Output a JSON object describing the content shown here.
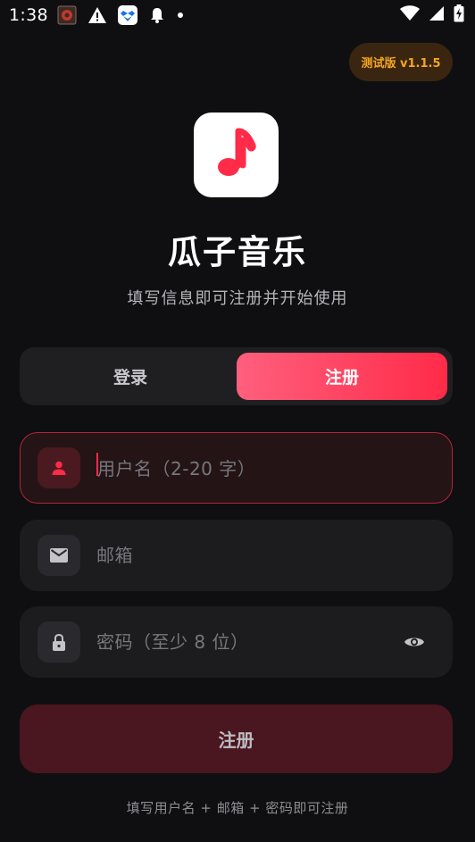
{
  "status_bar": {
    "time": "1:38",
    "notification_icons": [
      "app-notification-icon",
      "warning-icon",
      "dropbox-icon",
      "bell-icon",
      "dot-icon"
    ],
    "system_icons": [
      "wifi-icon",
      "signal-icon",
      "battery-charging-icon"
    ]
  },
  "version_badge": "测试版 v1.1.5",
  "app": {
    "name": "瓜子音乐",
    "subtitle": "填写信息即可注册并开始使用",
    "icon": "music-note-icon"
  },
  "tabs": [
    {
      "label": "登录",
      "selected": false
    },
    {
      "label": "注册",
      "selected": true
    }
  ],
  "form": {
    "username": {
      "placeholder": "用户名（2-20 字）",
      "value": "",
      "icon": "person-icon"
    },
    "email": {
      "placeholder": "邮箱",
      "value": "",
      "icon": "mail-icon"
    },
    "password": {
      "placeholder": "密码（至少 8 位）",
      "value": "",
      "icon": "lock-icon"
    }
  },
  "submit_label": "注册",
  "hint": "填写用户名 + 邮箱 + 密码即可注册",
  "colors": {
    "background": "#0f0f12",
    "accent": "#ff2b48",
    "accent_gradient_start": "#ff5f7e",
    "badge_text": "#f5a623",
    "submit_disabled": "#4a1620"
  }
}
